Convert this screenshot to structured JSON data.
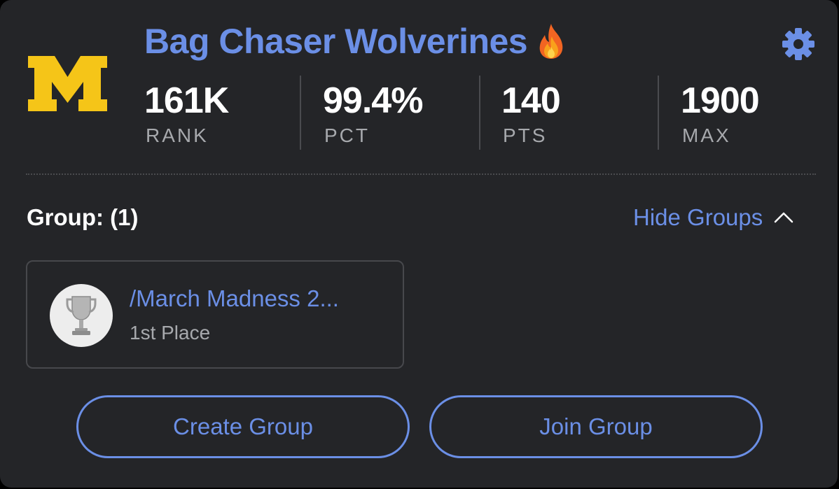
{
  "team": {
    "name": "Bag Chaser Wolverines",
    "logo_letter": "M",
    "badge_icon": "fire-emoji"
  },
  "stats": [
    {
      "value": "161K",
      "label": "RANK"
    },
    {
      "value": "99.4%",
      "label": "PCT"
    },
    {
      "value": "140",
      "label": "PTS"
    },
    {
      "value": "1900",
      "label": "MAX"
    }
  ],
  "groups": {
    "heading": "Group: (1)",
    "toggle_label": "Hide Groups",
    "toggle_icon": "chevron-up-icon",
    "items": [
      {
        "name": "/March Madness 2...",
        "place": "1st Place",
        "icon": "trophy-icon"
      }
    ]
  },
  "actions": {
    "create_label": "Create Group",
    "join_label": "Join Group"
  },
  "colors": {
    "background": "#242528",
    "accent": "#6b8fe6",
    "logo": "#f5c518",
    "text": "#ffffff",
    "muted": "#a7a9ad"
  }
}
